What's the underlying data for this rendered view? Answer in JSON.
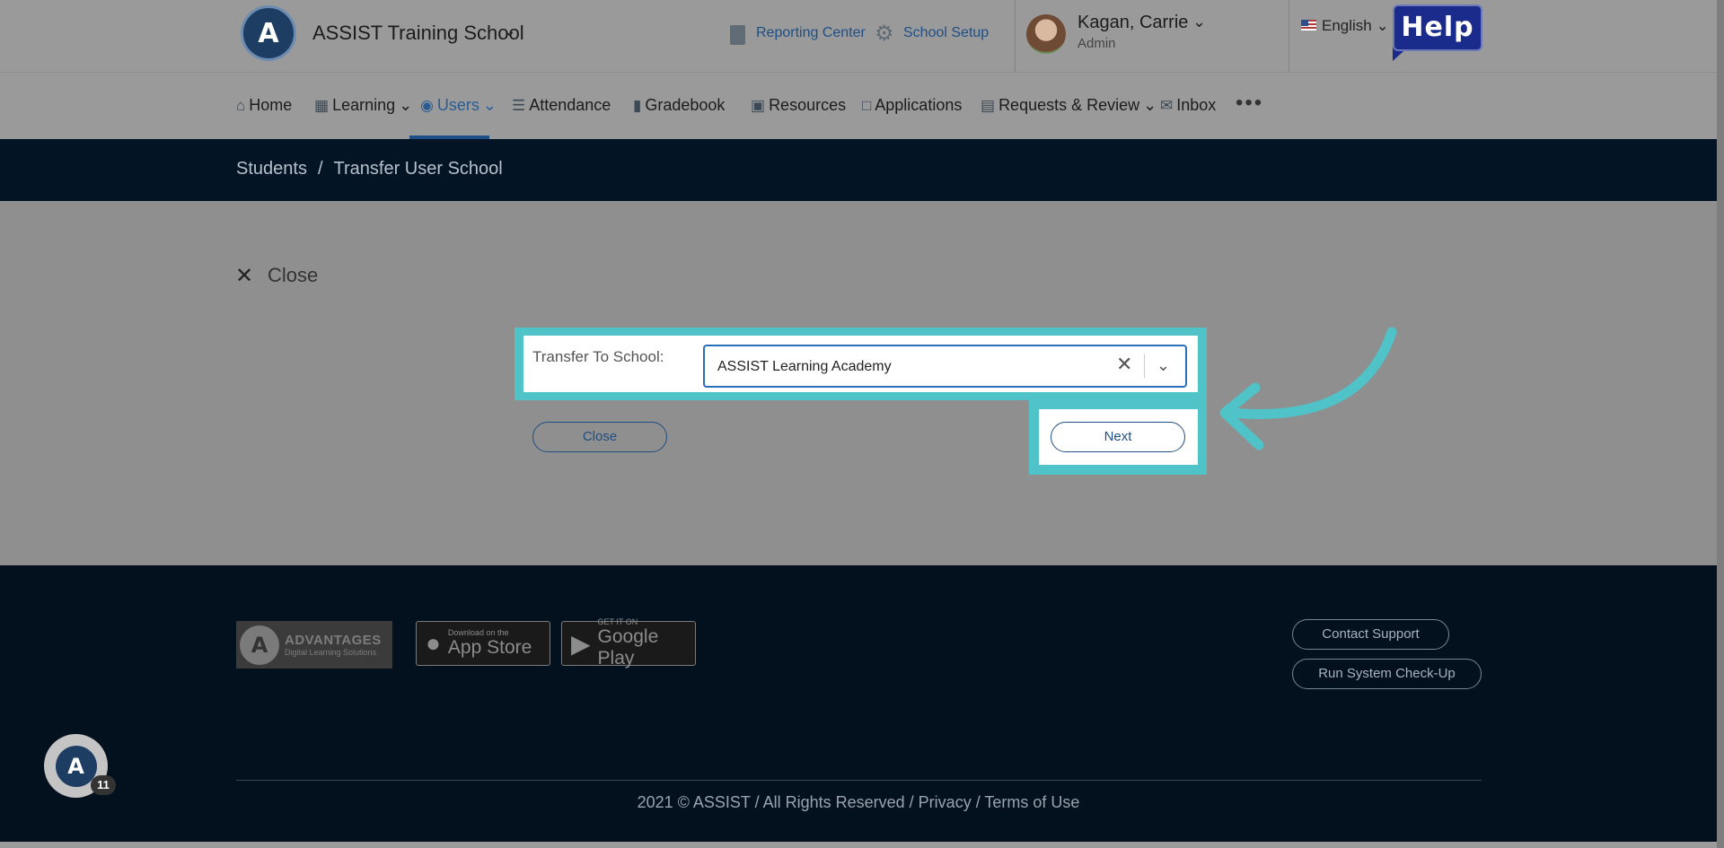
{
  "header": {
    "logo_letter": "A",
    "school_name": "ASSIST Training School",
    "reporting_center": "Reporting Center",
    "school_setup": "School Setup",
    "user_name": "Kagan, Carrie",
    "user_role": "Admin",
    "language": "English",
    "help_label": "Help"
  },
  "nav": {
    "items": [
      {
        "label": "Home",
        "icon": "home-icon"
      },
      {
        "label": "Learning",
        "icon": "learning-icon"
      },
      {
        "label": "Users",
        "icon": "user-icon"
      },
      {
        "label": "Attendance",
        "icon": "attendance-icon"
      },
      {
        "label": "Gradebook",
        "icon": "book-icon"
      },
      {
        "label": "Resources",
        "icon": "inbox-tray-icon"
      },
      {
        "label": "Applications",
        "icon": "chat-icon"
      },
      {
        "label": "Requests & Review",
        "icon": "clipboard-icon"
      },
      {
        "label": "Inbox",
        "icon": "mail-icon"
      }
    ],
    "active": "Users"
  },
  "breadcrumb": {
    "parent": "Students",
    "separator": "/",
    "current": "Transfer User School"
  },
  "form": {
    "close_link": "Close",
    "field_label": "Transfer To School:",
    "selected_school": "ASSIST Learning Academy",
    "close_button": "Close",
    "next_button": "Next"
  },
  "footer": {
    "advantages_title": "ADVANTAGES",
    "advantages_subtitle": "Digital Learning Solutions",
    "app_store_small": "Download on the",
    "app_store_big": "App Store",
    "google_play_small": "GET IT ON",
    "google_play_big": "Google Play",
    "contact_support": "Contact Support",
    "run_checkup": "Run System Check-Up",
    "copyright": "2021 © ASSIST / All Rights Reserved / Privacy / Terms of Use"
  },
  "chat": {
    "badge_count": "11"
  },
  "colors": {
    "highlight": "#4fc3c8",
    "brand_blue": "#1d4f86",
    "dark_band": "#031424"
  }
}
